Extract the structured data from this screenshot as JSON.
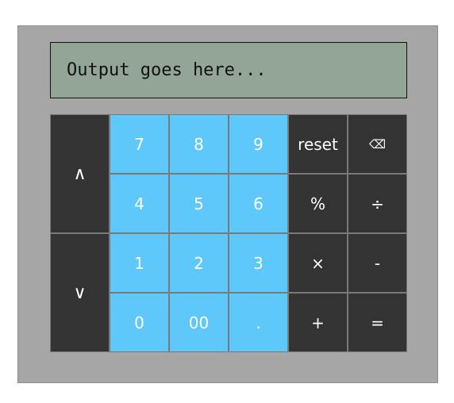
{
  "display": {
    "text": "Output goes here..."
  },
  "keys": {
    "up": "∧",
    "down": "∨",
    "seven": "7",
    "eight": "8",
    "nine": "9",
    "reset": "reset",
    "backspace": "⌫",
    "four": "4",
    "five": "5",
    "six": "6",
    "percent": "%",
    "divide": "÷",
    "one": "1",
    "two": "2",
    "three": "3",
    "multiply": "×",
    "minus": "-",
    "zero": "0",
    "double_zero": "00",
    "decimal": ".",
    "plus": "+",
    "equals": "="
  },
  "colors": {
    "digit_key": "#5ec8fb",
    "operator_key": "#333333",
    "display_bg": "#93a595",
    "body_bg": "#a6a6a6"
  }
}
